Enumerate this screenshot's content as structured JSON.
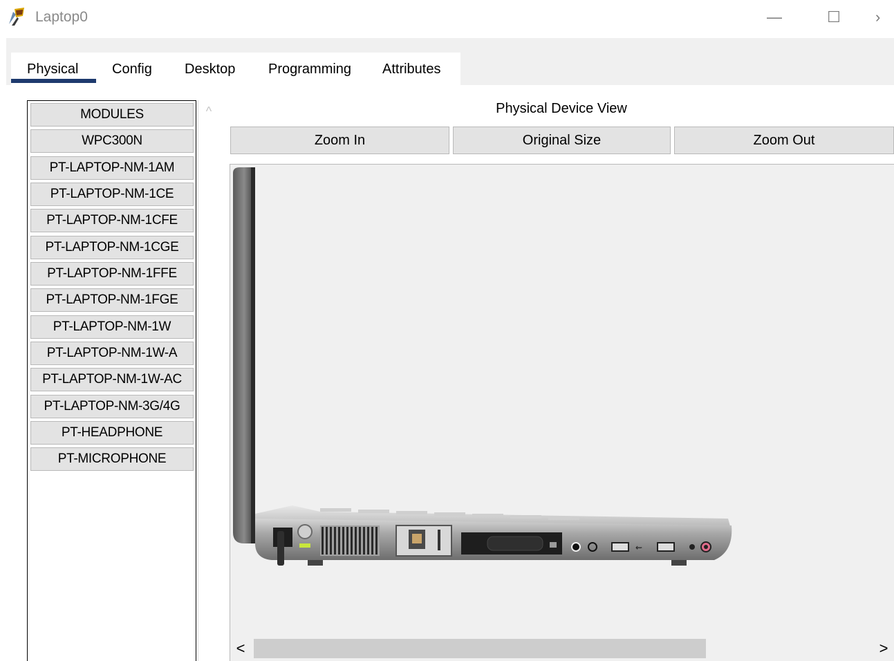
{
  "window": {
    "title": "Laptop0",
    "minimize_glyph": "—",
    "maximize_glyph": "☐",
    "close_glyph": "›"
  },
  "tabs": [
    {
      "label": "Physical",
      "active": true
    },
    {
      "label": "Config",
      "active": false
    },
    {
      "label": "Desktop",
      "active": false
    },
    {
      "label": "Programming",
      "active": false
    },
    {
      "label": "Attributes",
      "active": false
    }
  ],
  "modules": {
    "items": [
      "MODULES",
      "WPC300N",
      "PT-LAPTOP-NM-1AM",
      "PT-LAPTOP-NM-1CE",
      "PT-LAPTOP-NM-1CFE",
      "PT-LAPTOP-NM-1CGE",
      "PT-LAPTOP-NM-1FFE",
      "PT-LAPTOP-NM-1FGE",
      "PT-LAPTOP-NM-1W",
      "PT-LAPTOP-NM-1W-A",
      "PT-LAPTOP-NM-1W-AC",
      "PT-LAPTOP-NM-3G/4G",
      "PT-HEADPHONE",
      "PT-MICROPHONE"
    ],
    "scroll_up_glyph": "^"
  },
  "view": {
    "title": "Physical Device View",
    "zoom_in": "Zoom In",
    "original_size": "Original Size",
    "zoom_out": "Zoom Out"
  },
  "hscroll": {
    "left_glyph": "<",
    "right_glyph": ">"
  },
  "colors": {
    "tab_underline": "#1e3a6e",
    "panel_bg": "#f0f0f0",
    "button_bg": "#e3e3e3",
    "laptop_body": "#8e8e8e",
    "power_led": "#c8e63c"
  },
  "icons": {
    "app": "packet-tracer-laptop-icon",
    "device": "laptop-side-view-image"
  }
}
